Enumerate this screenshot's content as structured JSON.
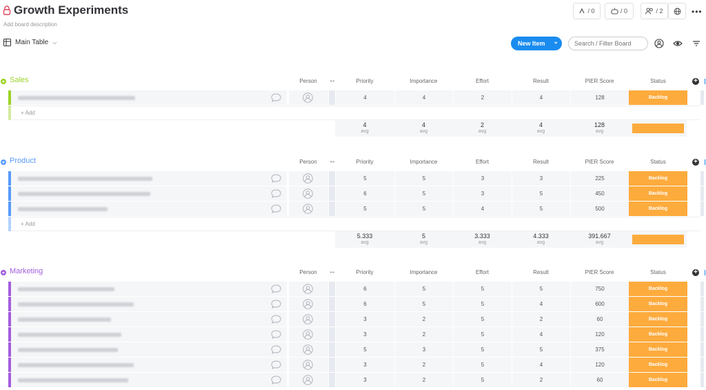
{
  "board": {
    "title": "Growth Experiments",
    "description": "Add board description",
    "counters": {
      "activity": "/ 0",
      "integrations": "/ 0",
      "members": "/ 2"
    },
    "view": "Main Table",
    "new_item": "New Item",
    "search_placeholder": "Search / Filter Board"
  },
  "columns": {
    "person": "Person",
    "priority": "Priority",
    "importance": "Importance",
    "effort": "Effort",
    "result": "Result",
    "pier": "PIER Score",
    "status": "Status"
  },
  "add_label": "+ Add",
  "avg_label": "avg",
  "colors": {
    "sales": "#9cd326",
    "product": "#579bfc",
    "marketing": "#a25ddc",
    "status_backlog": "#fdab3d",
    "primary": "#1a8cf0"
  },
  "groups": [
    {
      "name": "Sales",
      "rows": [
        {
          "priority": "4",
          "importance": "4",
          "effort": "2",
          "result": "4",
          "pier": "128",
          "status": "Backlog"
        }
      ],
      "summary": {
        "priority": "4",
        "importance": "4",
        "effort": "2",
        "result": "4",
        "pier": "128"
      }
    },
    {
      "name": "Product",
      "rows": [
        {
          "priority": "5",
          "importance": "5",
          "effort": "3",
          "result": "3",
          "pier": "225",
          "status": "Backlog"
        },
        {
          "priority": "6",
          "importance": "5",
          "effort": "3",
          "result": "5",
          "pier": "450",
          "status": "Backlog"
        },
        {
          "priority": "5",
          "importance": "5",
          "effort": "4",
          "result": "5",
          "pier": "500",
          "status": "Backlog"
        }
      ],
      "summary": {
        "priority": "5.333",
        "importance": "5",
        "effort": "3.333",
        "result": "4.333",
        "pier": "391.667"
      }
    },
    {
      "name": "Marketing",
      "rows": [
        {
          "priority": "6",
          "importance": "5",
          "effort": "5",
          "result": "5",
          "pier": "750",
          "status": "Backlog"
        },
        {
          "priority": "6",
          "importance": "5",
          "effort": "5",
          "result": "4",
          "pier": "600",
          "status": "Backlog"
        },
        {
          "priority": "3",
          "importance": "2",
          "effort": "5",
          "result": "2",
          "pier": "60",
          "status": "Backlog"
        },
        {
          "priority": "3",
          "importance": "2",
          "effort": "5",
          "result": "4",
          "pier": "120",
          "status": "Backlog"
        },
        {
          "priority": "5",
          "importance": "3",
          "effort": "5",
          "result": "5",
          "pier": "375",
          "status": "Backlog"
        },
        {
          "priority": "3",
          "importance": "2",
          "effort": "5",
          "result": "4",
          "pier": "120",
          "status": "Backlog"
        },
        {
          "priority": "3",
          "importance": "2",
          "effort": "5",
          "result": "2",
          "pier": "60",
          "status": "Backlog"
        }
      ]
    }
  ]
}
